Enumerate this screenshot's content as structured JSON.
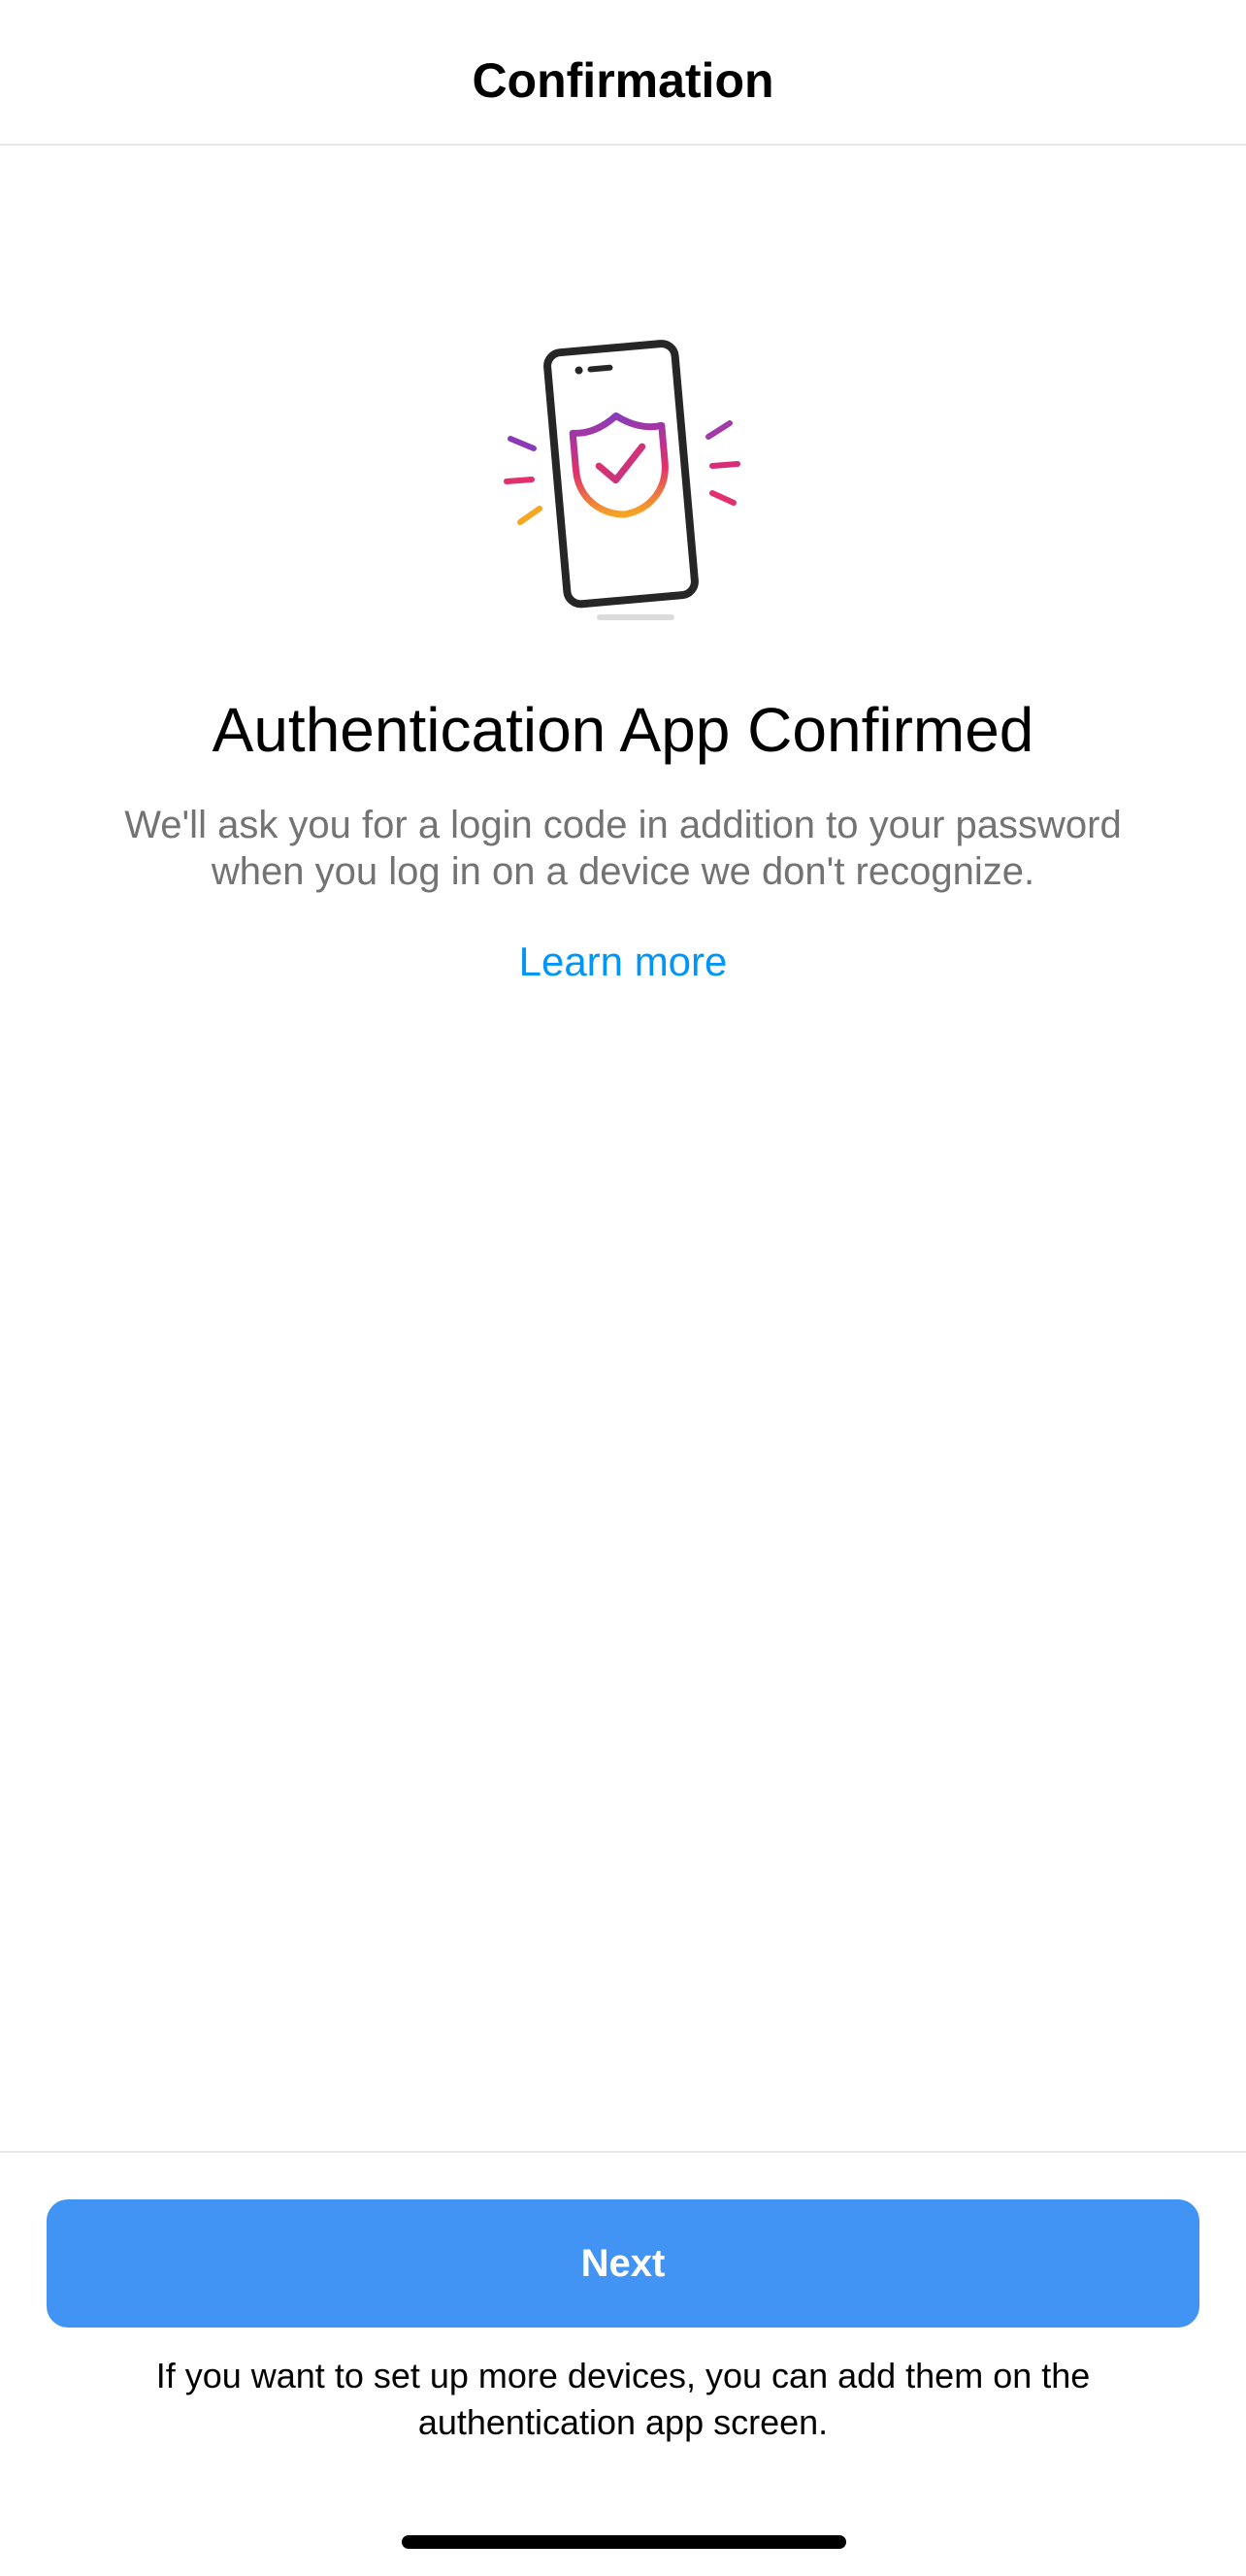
{
  "header": {
    "title": "Confirmation"
  },
  "illustration": {
    "icon": "phone-shield-check-icon"
  },
  "main": {
    "headline": "Authentication App Confirmed",
    "description_line1": "We'll ask you for a login code in addition to your password",
    "description_line2": "when you log in on a device we don't recognize.",
    "learn_more_label": "Learn more"
  },
  "footer": {
    "next_label": "Next",
    "note_line1": "If you want to set up more devices, you can add them on the",
    "note_line2": "authentication app screen."
  },
  "colors": {
    "accent_link": "#0095f6",
    "button_primary": "#4294f4",
    "secondary_text": "#737373",
    "gradient_start": "#8a3ab9",
    "gradient_mid": "#e1306c",
    "gradient_end": "#f5a623"
  }
}
